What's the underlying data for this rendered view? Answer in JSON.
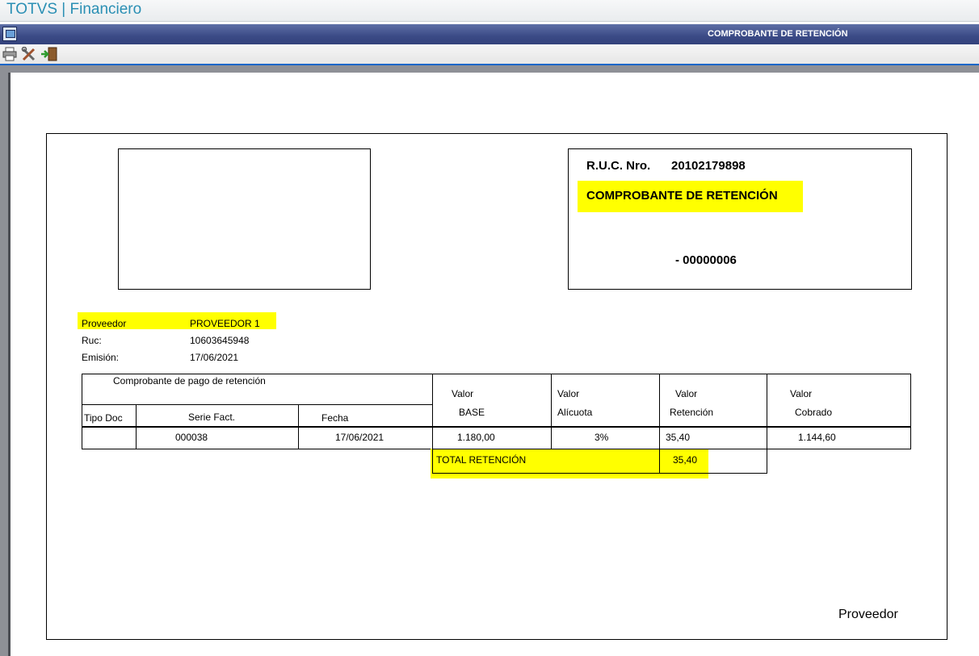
{
  "app": {
    "title": "TOTVS | Financiero"
  },
  "window": {
    "title": "COMPROBANTE DE RETENCIÓN"
  },
  "toolbar": {
    "icons": [
      "printer-icon",
      "tools-icon",
      "exit-icon"
    ]
  },
  "doc": {
    "ruc_label": "R.U.C. Nro.",
    "ruc_value": "20102179898",
    "doc_title": "COMPROBANTE DE RETENCIÓN",
    "doc_number": "- 00000006",
    "proveedor_label": "Proveedor",
    "proveedor_value": "PROVEEDOR 1",
    "ruc2_label": "Ruc:",
    "ruc2_value": "10603645948",
    "emision_label": "Emisión:",
    "emision_value": "17/06/2021",
    "footer_label": "Proveedor"
  },
  "table": {
    "group_header": "Comprobante de pago de retención",
    "col_tipo": "Tipo Doc",
    "col_serie": "Serie Fact.",
    "col_fecha": "Fecha",
    "col_base_1": "Valor",
    "col_base_2": "BASE",
    "col_alic_1": "Valor",
    "col_alic_2": "Alícuota",
    "col_ret_1": "Valor",
    "col_ret_2": "Retención",
    "col_cob_1": "Valor",
    "col_cob_2": "Cobrado",
    "row": {
      "tipo": "",
      "serie": "000038",
      "fecha": "17/06/2021",
      "base": "1.180,00",
      "alicuota": "3%",
      "retencion": "35,40",
      "cobrado": "1.144,60"
    },
    "total_label": "TOTAL RETENCIÓN",
    "total_value": "35,40"
  },
  "colors": {
    "accent": "#2a8fb4",
    "window_bar": "#3b4a86",
    "highlight": "#ffff00"
  }
}
